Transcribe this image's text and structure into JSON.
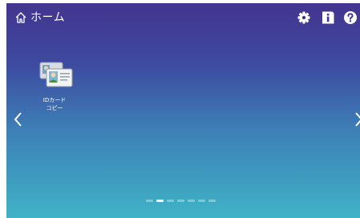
{
  "header": {
    "title": "ホーム",
    "home_icon": "home-icon",
    "buttons": [
      {
        "name": "settings-button",
        "icon": "gear-icon"
      },
      {
        "name": "info-button",
        "icon": "info-icon"
      },
      {
        "name": "help-button",
        "icon": "question-icon"
      }
    ]
  },
  "apps": [
    {
      "label_line1": "IDカード",
      "label_line2": "コピー",
      "icon": "id-card-icon"
    }
  ],
  "navigation": {
    "left_icon": "chevron-left-icon",
    "right_icon": "chevron-right-icon"
  },
  "pager": {
    "page_count": 7,
    "current_page": 2
  },
  "colors": {
    "bg_top": "#43348f",
    "bg_bottom": "#40b3c6",
    "text": "#ffffff"
  }
}
